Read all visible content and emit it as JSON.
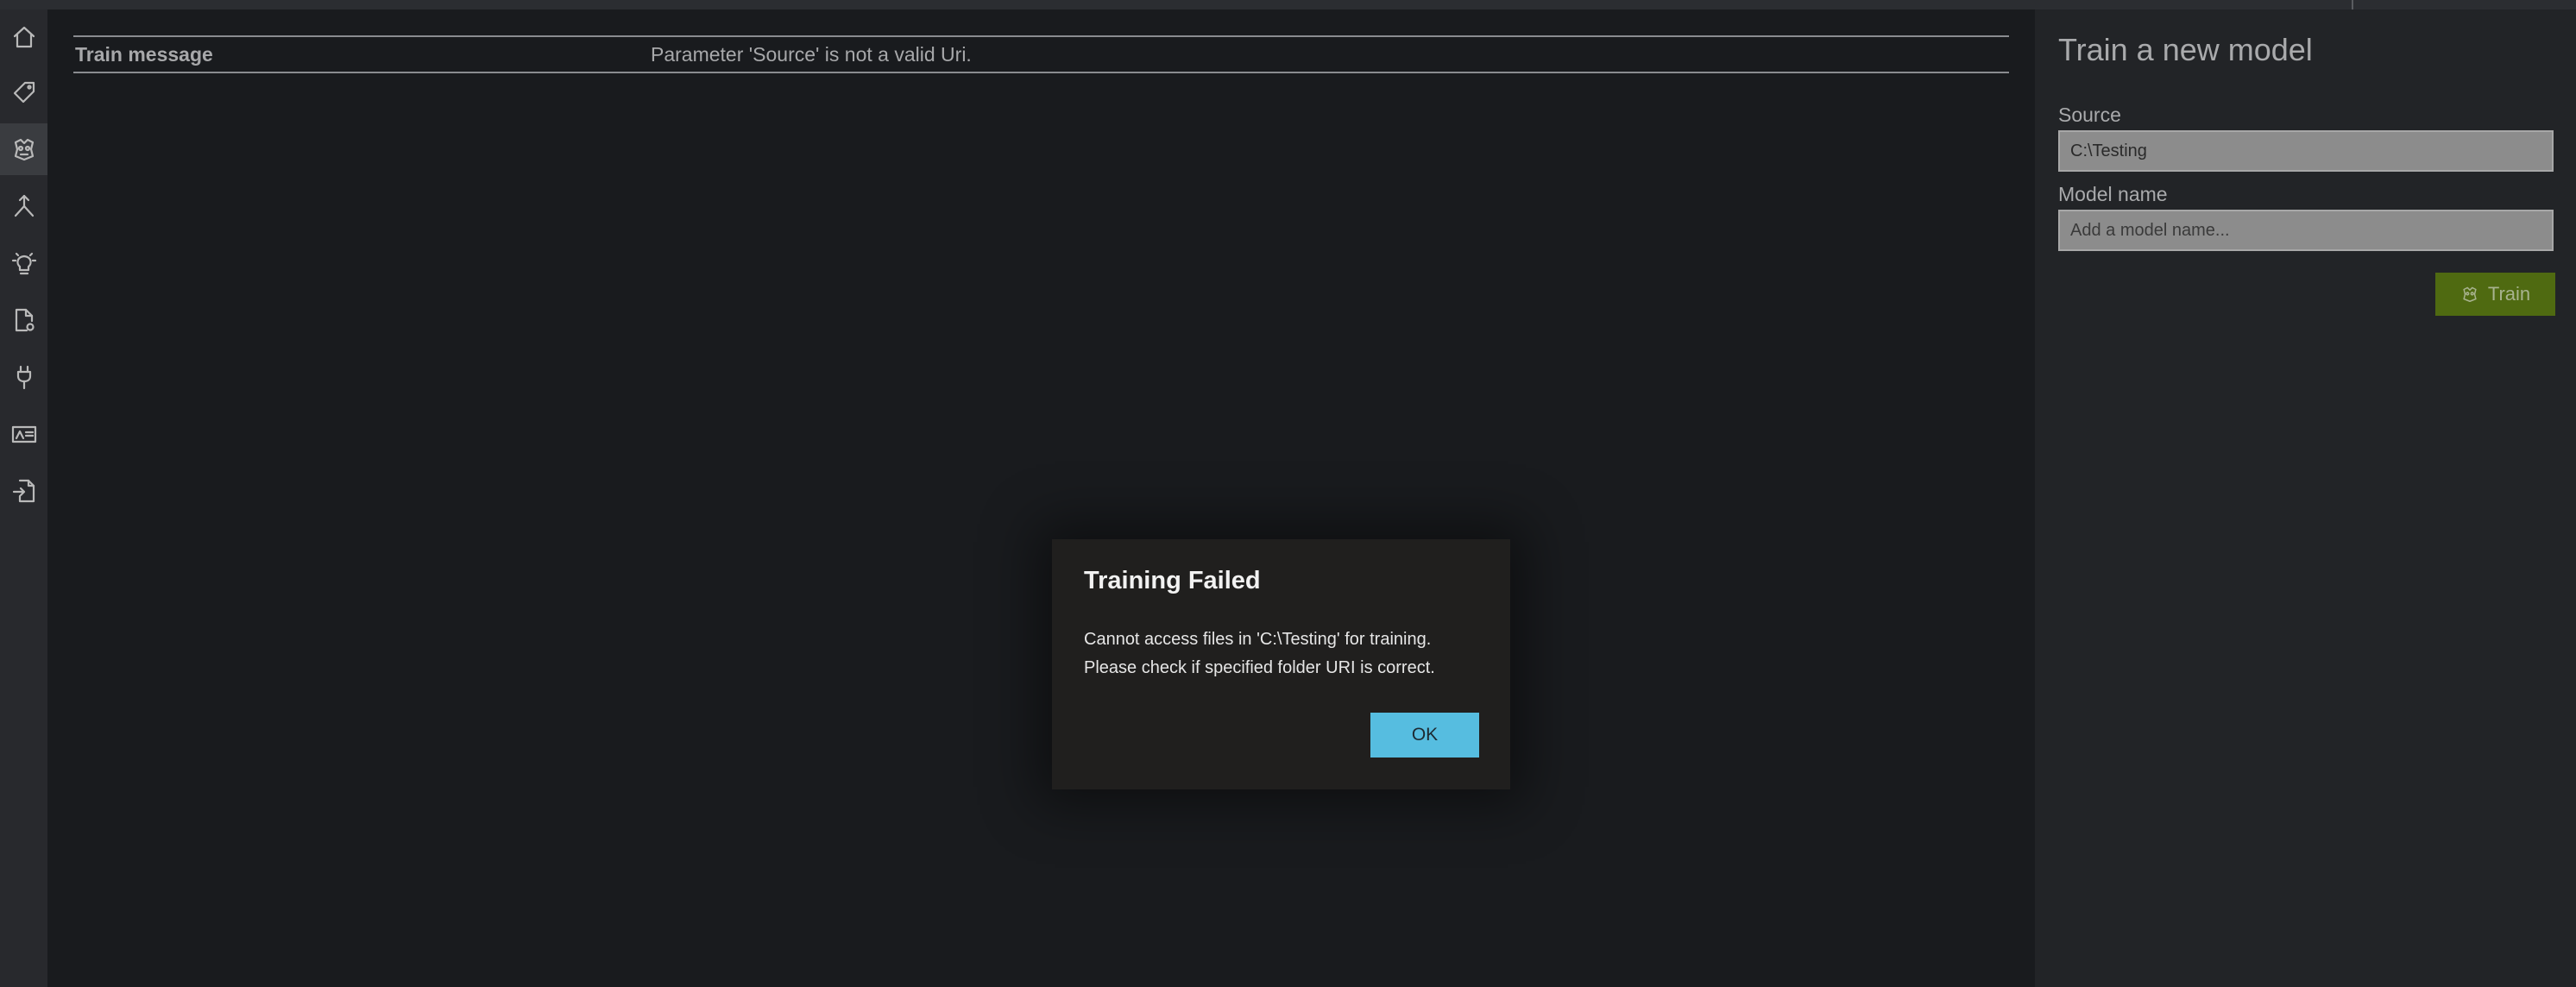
{
  "sidebar": {
    "items": [
      {
        "icon": "home-icon"
      },
      {
        "icon": "tag-icon"
      },
      {
        "icon": "model-icon",
        "active": true
      },
      {
        "icon": "merge-icon"
      },
      {
        "icon": "lightbulb-icon"
      },
      {
        "icon": "document-settings-icon"
      },
      {
        "icon": "plug-icon"
      },
      {
        "icon": "id-card-icon"
      },
      {
        "icon": "document-export-icon"
      }
    ]
  },
  "main": {
    "train_message_label": "Train message",
    "train_message_value": "Parameter 'Source' is not a valid Uri."
  },
  "panel": {
    "title": "Train a new model",
    "source_label": "Source",
    "source_value": "C:\\Testing",
    "model_name_label": "Model name",
    "model_name_placeholder": "Add a model name...",
    "train_button_label": "Train"
  },
  "dialog": {
    "title": "Training Failed",
    "line1": "Cannot access files in 'C:\\Testing' for training.",
    "line2": "Please check if specified folder URI is correct.",
    "ok_label": "OK"
  },
  "colors": {
    "accent": "#56bde0",
    "train_button": "#4f6a11",
    "background": "#191b1e"
  }
}
